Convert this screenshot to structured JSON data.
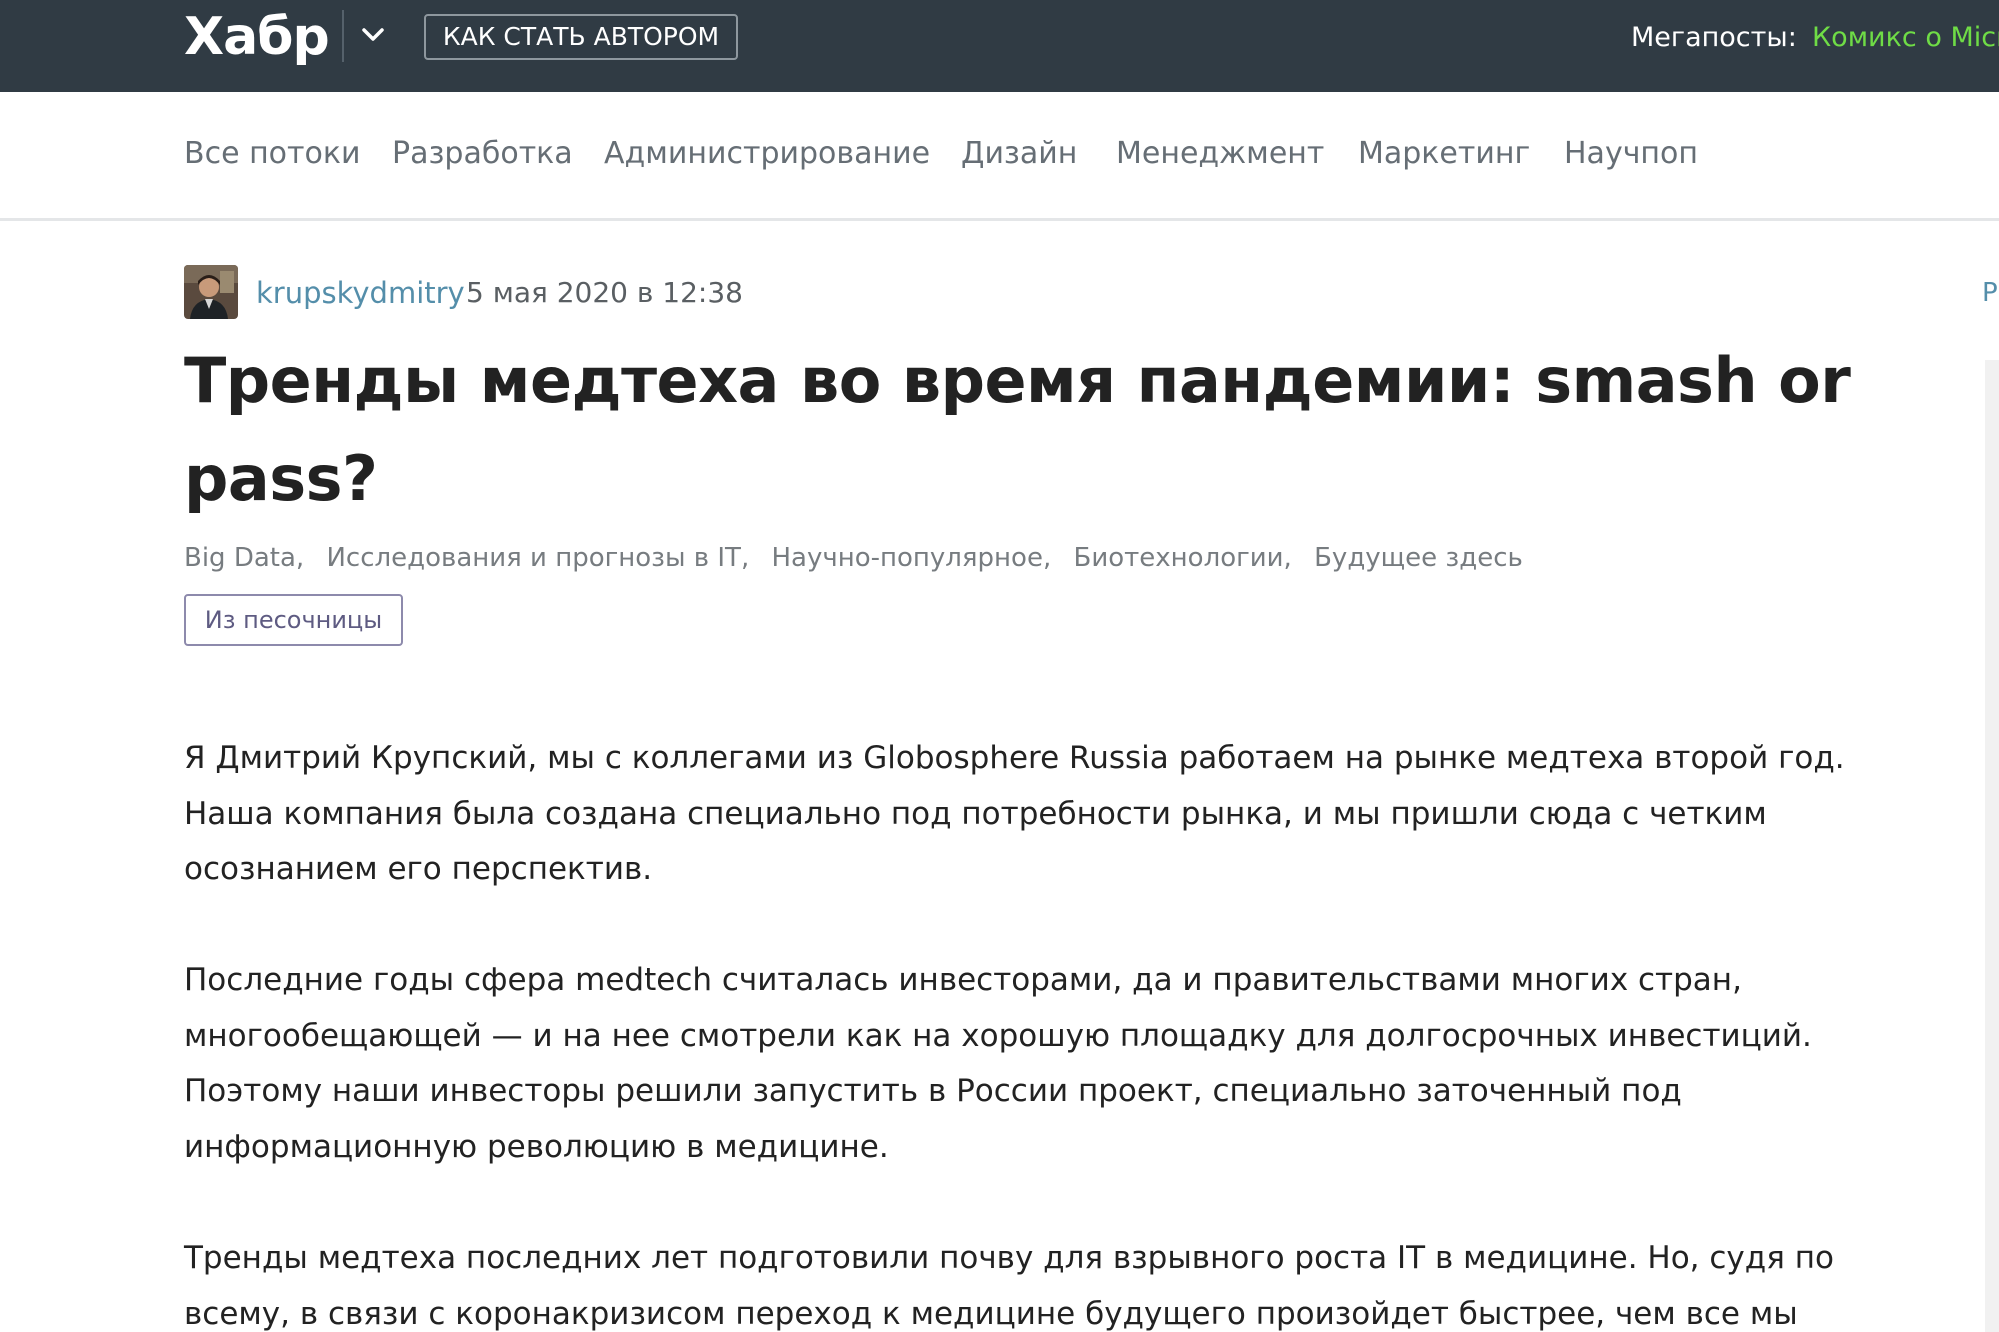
{
  "header": {
    "logo": "Хабр",
    "author_button": "КАК СТАТЬ АВТОРОМ",
    "megaposts_label": "Мегапосты:",
    "megapost_link": "Комикс о Micr"
  },
  "nav": {
    "items": [
      {
        "label": "Все потоки"
      },
      {
        "label": "Разработка"
      },
      {
        "label": "Администрирование"
      },
      {
        "label": "Дизайн"
      },
      {
        "label": "Менеджмент"
      },
      {
        "label": "Маркетинг"
      },
      {
        "label": "Научпоп"
      }
    ]
  },
  "post": {
    "author": "krupskydmitry",
    "date": "5 мая 2020 в 12:38",
    "right_edge_text": "Р",
    "title_line1": "Тренды медтеха во время пандемии: smash or",
    "title_line2": "pass?",
    "hubs": [
      {
        "label": "Big Data,"
      },
      {
        "label": "Исследования и прогнозы в IT,"
      },
      {
        "label": "Научно-популярное,"
      },
      {
        "label": "Биотехнологии,"
      },
      {
        "label": "Будущее здесь"
      }
    ],
    "sandbox_badge": "Из песочницы",
    "paragraphs": [
      {
        "lines": [
          "Я Дмитрий Крупский, мы с коллегами из Globosphere Russia работаем на рынке медтеха второй год.",
          "Наша компания была создана специально под потребности рынка, и мы пришли сюда с четким",
          "осознанием его перспектив."
        ]
      },
      {
        "lines": [
          "Последние годы сфера medtech считалась инвесторами, да и правительствами многих стран,",
          "многообещающей — и на нее смотрели как на хорошую площадку для долгосрочных инвестиций.",
          "Поэтому наши инвесторы решили запустить в России проект, специально заточенный под",
          "информационную революцию в медицине."
        ]
      },
      {
        "lines": [
          "Тренды медтеха последних лет подготовили почву для взрывного роста IT в медицине. Но, судя по",
          "всему, в связи с коронакризисом переход к медицине будущего произойдет быстрее, чем все мы"
        ]
      }
    ]
  }
}
